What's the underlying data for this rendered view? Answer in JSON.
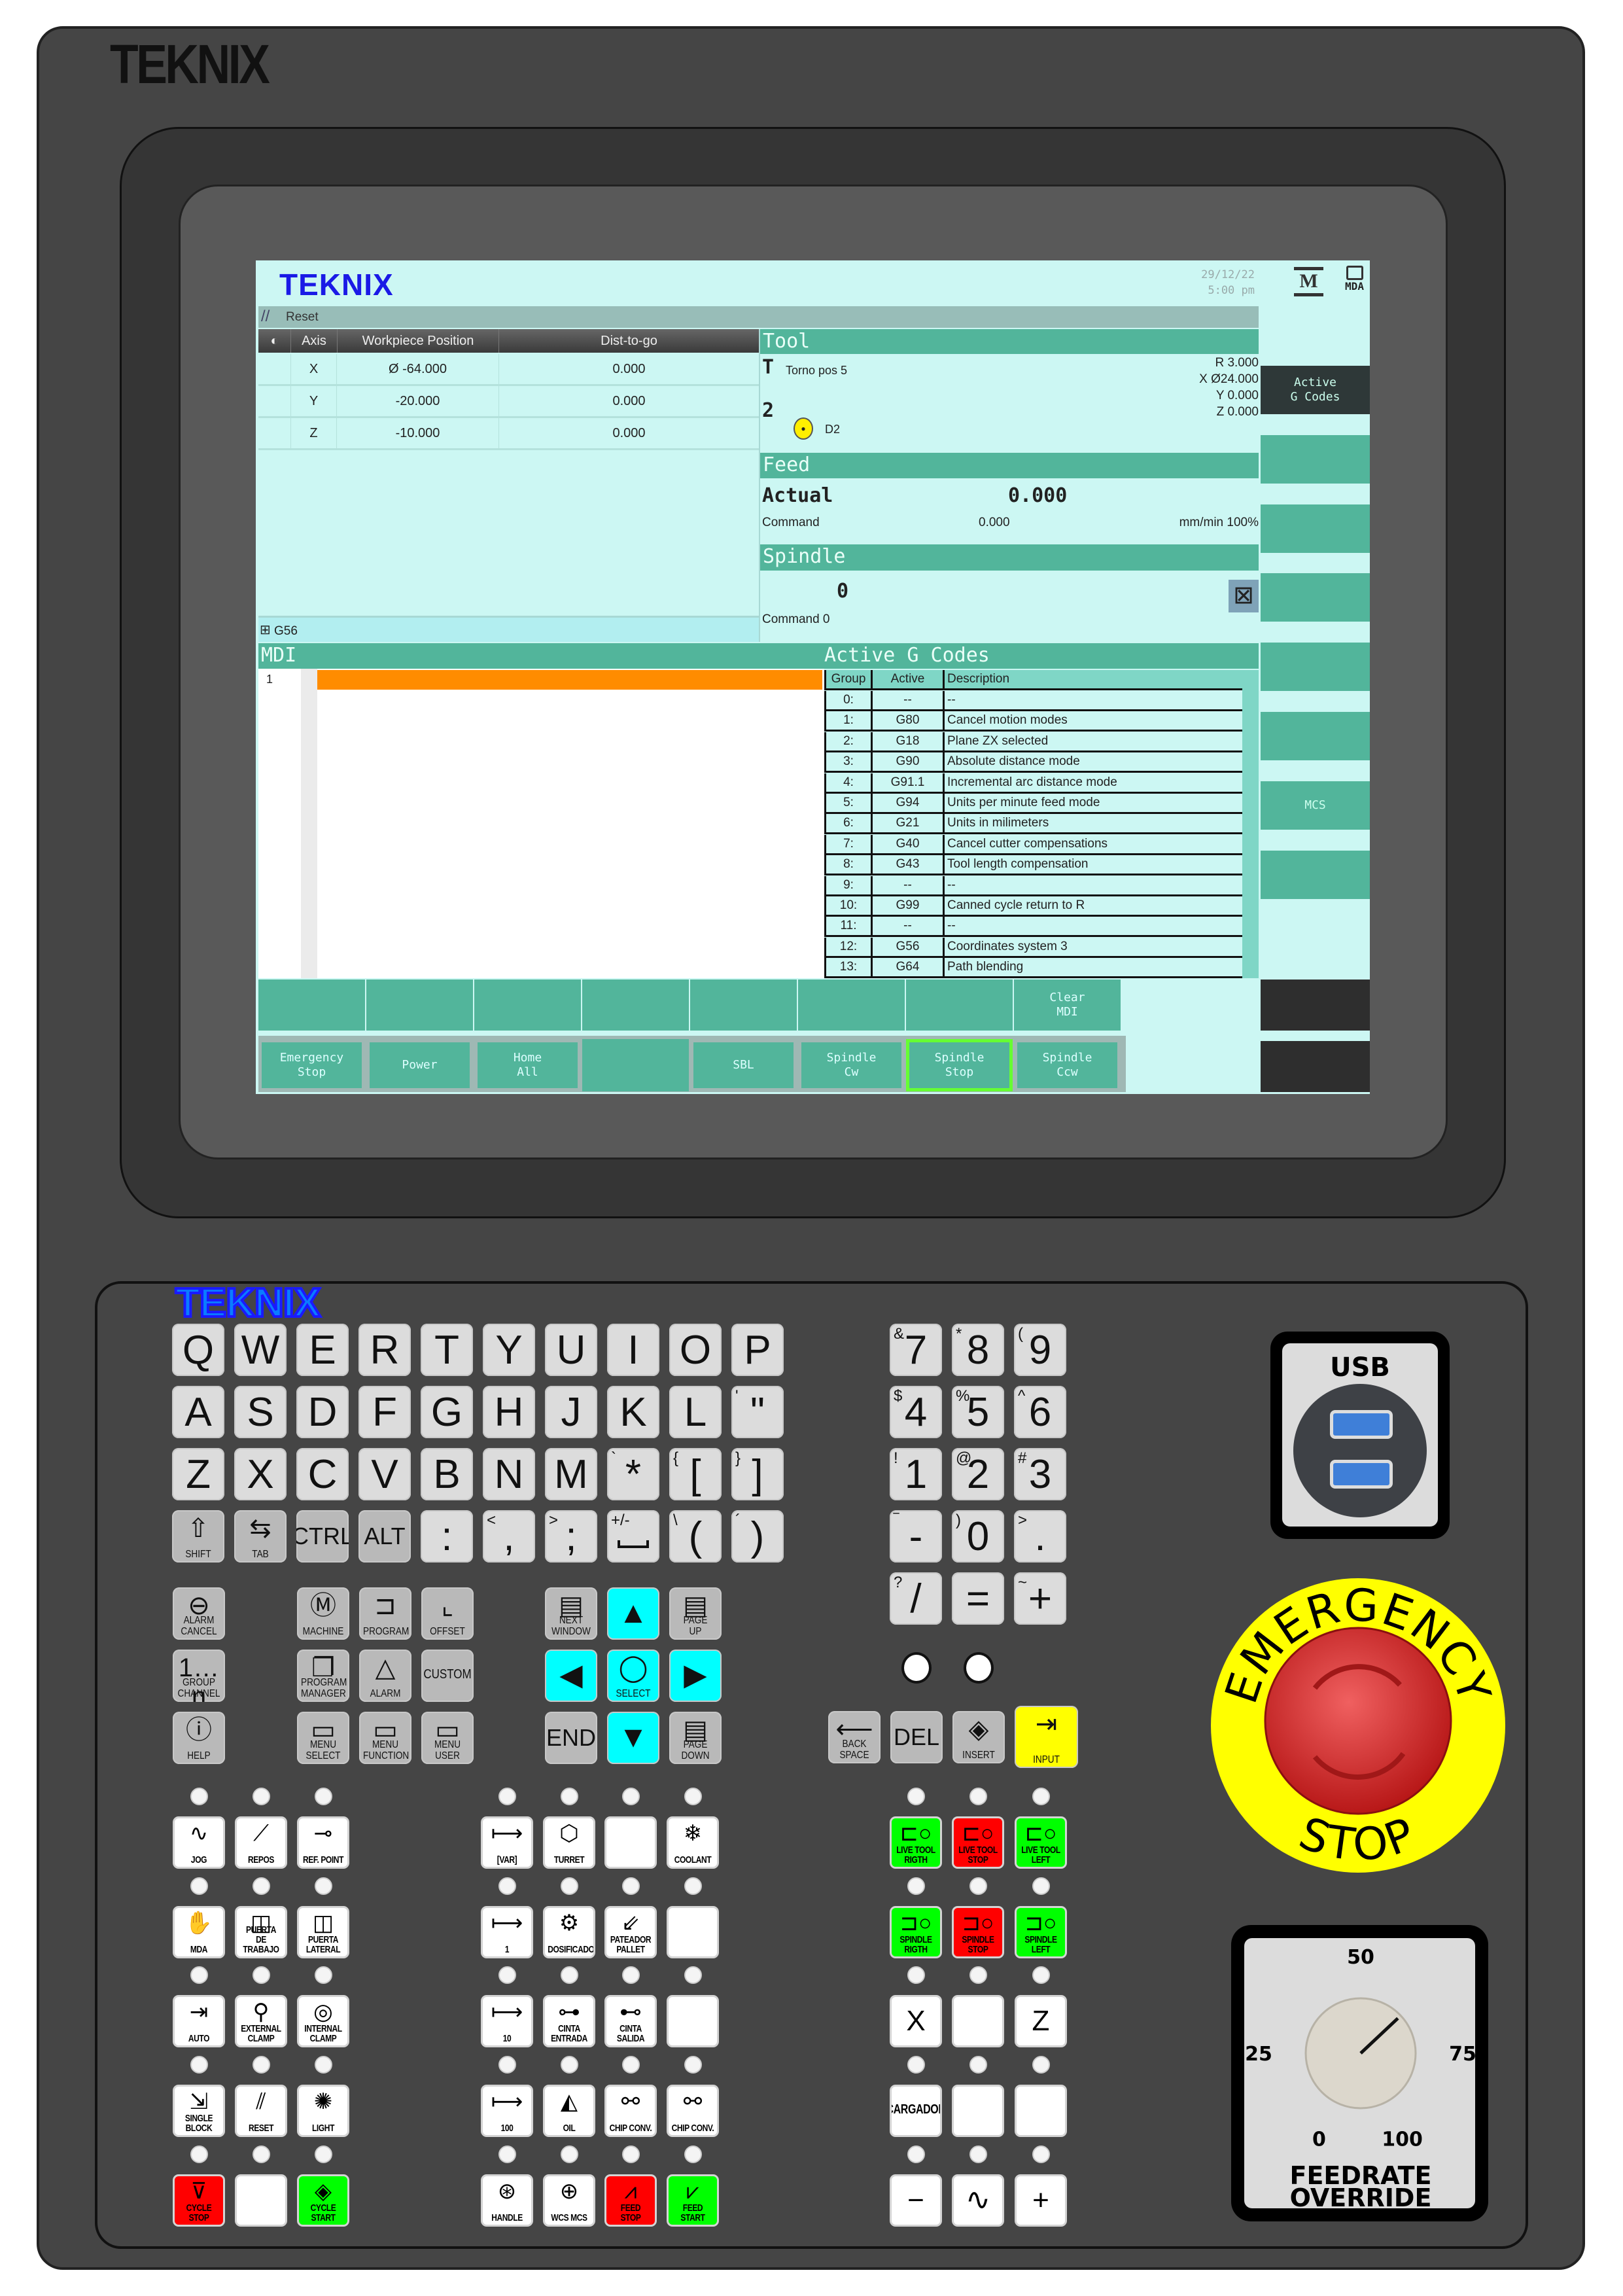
{
  "brand": "TEKNIX",
  "screen": {
    "logo": "TEKNIX",
    "date": "29/12/22",
    "time": "5:00 pm",
    "mode_icons": [
      "M",
      "MDA"
    ],
    "status": "Reset",
    "axes": {
      "headers": [
        "Axis",
        "Workpiece Position",
        "Dist-to-go"
      ],
      "rows": [
        [
          "X",
          "Ø -64.000",
          "0.000"
        ],
        [
          "Y",
          "-20.000",
          "0.000"
        ],
        [
          "Z",
          "-10.000",
          "0.000"
        ]
      ]
    },
    "wcs": "G56",
    "tool": {
      "title": "Tool",
      "t_label": "T",
      "name": "Torno pos 5",
      "number": "2",
      "d": "D2",
      "r": "R 3.000",
      "x": "X Ø24.000",
      "y": "Y 0.000",
      "z": "Z 0.000"
    },
    "feed": {
      "title": "Feed",
      "actual_label": "Actual",
      "actual": "0.000",
      "command_label": "Command",
      "command": "0.000",
      "unit": "mm/min 100%"
    },
    "spindle": {
      "title": "Spindle",
      "value": "0",
      "command": "Command 0"
    },
    "mdi": {
      "title": "MDI",
      "line": "1"
    },
    "gcodes": {
      "title": "Active G Codes",
      "headers": [
        "Group",
        "Active",
        "Description"
      ],
      "rows": [
        [
          "0:",
          "--",
          "--"
        ],
        [
          "1:",
          "G80",
          "Cancel motion modes"
        ],
        [
          "2:",
          "G18",
          "Plane ZX selected"
        ],
        [
          "3:",
          "G90",
          "Absolute distance mode"
        ],
        [
          "4:",
          "G91.1",
          "Incremental arc distance mode"
        ],
        [
          "5:",
          "G94",
          "Units per minute feed mode"
        ],
        [
          "6:",
          "G21",
          "Units in milimeters"
        ],
        [
          "7:",
          "G40",
          "Cancel cutter compensations"
        ],
        [
          "8:",
          "G43",
          "Tool length compensation"
        ],
        [
          "9:",
          "--",
          "--"
        ],
        [
          "10:",
          "G99",
          "Canned cycle return to R"
        ],
        [
          "11:",
          "--",
          "--"
        ],
        [
          "12:",
          "G56",
          "Coordinates system 3"
        ],
        [
          "13:",
          "G64",
          "Path blending"
        ]
      ]
    },
    "right_softkeys": [
      "Active\nG Codes",
      "",
      "",
      "",
      "",
      "",
      "MCS",
      ""
    ],
    "bottom_softkeys_1": [
      "",
      "",
      "",
      "",
      "",
      "",
      "",
      "Clear\nMDI"
    ],
    "bottom_softkeys_2": [
      "Emergency\nStop",
      "Power",
      "Home\nAll",
      "",
      "SBL",
      "Spindle\nCw",
      "Spindle\nStop",
      "Spindle\nCcw"
    ],
    "active_softkey": "Spindle\nStop",
    "colors": {
      "background": "#ccf7f3",
      "header": "#52b59b",
      "cursor_line": "#ff8c00",
      "logo": "#1a1ae6",
      "active_border": "#66ff33"
    }
  },
  "keyboard": {
    "alpha_rows": [
      [
        [
          "Q",
          ""
        ],
        [
          "W",
          ""
        ],
        [
          "E",
          ""
        ],
        [
          "R",
          ""
        ],
        [
          "T",
          ""
        ],
        [
          "Y",
          ""
        ],
        [
          "U",
          ""
        ],
        [
          "I",
          ""
        ],
        [
          "O",
          ""
        ],
        [
          "P",
          ""
        ]
      ],
      [
        [
          "A",
          ""
        ],
        [
          "S",
          ""
        ],
        [
          "D",
          ""
        ],
        [
          "F",
          ""
        ],
        [
          "G",
          ""
        ],
        [
          "H",
          ""
        ],
        [
          "J",
          ""
        ],
        [
          "K",
          ""
        ],
        [
          "L",
          ""
        ],
        [
          "\"",
          "'"
        ]
      ],
      [
        [
          "Z",
          ""
        ],
        [
          "X",
          ""
        ],
        [
          "C",
          ""
        ],
        [
          "V",
          ""
        ],
        [
          "B",
          ""
        ],
        [
          "N",
          ""
        ],
        [
          "M",
          ""
        ],
        [
          "*",
          "`"
        ],
        [
          "[",
          "{"
        ],
        [
          "]",
          "}"
        ]
      ],
      [
        [
          ":",
          ""
        ],
        [
          ",",
          "<"
        ],
        [
          ";",
          ">"
        ],
        [
          "",
          "+/-"
        ],
        [
          "(",
          "\\"
        ],
        [
          ")",
          "´"
        ]
      ]
    ],
    "modifier_keys": [
      {
        "label": "SHIFT",
        "icon": "shift-arrow"
      },
      {
        "label": "TAB",
        "icon": "tab-arrows"
      },
      {
        "label": "CTRL"
      },
      {
        "label": "ALT"
      }
    ],
    "numpad_rows": [
      [
        [
          "7",
          "&"
        ],
        [
          "8",
          "*"
        ],
        [
          "9",
          "("
        ]
      ],
      [
        [
          "4",
          "$"
        ],
        [
          "5",
          "%"
        ],
        [
          "6",
          "^"
        ]
      ],
      [
        [
          "1",
          "!"
        ],
        [
          "2",
          "@"
        ],
        [
          "3",
          "#"
        ]
      ],
      [
        [
          "-",
          "‾"
        ],
        [
          "0",
          ")"
        ],
        [
          ".",
          ">"
        ]
      ],
      [
        [
          "/",
          "?"
        ],
        [
          "=",
          ""
        ],
        [
          "+",
          "~"
        ]
      ]
    ],
    "edit_keys": [
      {
        "label": "BACK\nSPACE",
        "icon": "backspace-arrow"
      },
      {
        "label": "DEL"
      },
      {
        "label": "INSERT",
        "icon": "insert"
      },
      {
        "label": "INPUT",
        "icon": "input",
        "color": "#ffff00"
      }
    ],
    "function_left": [
      {
        "label": "ALARM\nCANCEL",
        "icon": "alarm-cancel"
      },
      {
        "label": "GROUP\nCHANNEL",
        "icon": "group-channel"
      },
      {
        "label": "HELP",
        "icon": "help"
      }
    ],
    "function_middle": [
      [
        {
          "label": "MACHINE",
          "icon": "machine"
        },
        {
          "label": "PROGRAM",
          "icon": "program"
        },
        {
          "label": "OFFSET",
          "icon": "offset"
        }
      ],
      [
        {
          "label": "PROGRAM\nMANAGER",
          "icon": "program-manager"
        },
        {
          "label": "ALARM",
          "icon": "alarm"
        },
        {
          "label": "CUSTOM"
        }
      ],
      [
        {
          "label": "MENU\nSELECT",
          "icon": "menu"
        },
        {
          "label": "MENU\nFUNCTION",
          "icon": "menu"
        },
        {
          "label": "MENU\nUSER",
          "icon": "menu"
        }
      ]
    ],
    "navigation": [
      [
        {
          "label": "NEXT\nWINDOW",
          "icon": "next-window"
        },
        {
          "label": "",
          "icon": "arrow-up",
          "color": "#00ffff"
        },
        {
          "label": "PAGE\nUP",
          "icon": "page-up"
        }
      ],
      [
        {
          "label": "",
          "icon": "arrow-left",
          "color": "#00ffff"
        },
        {
          "label": "SELECT",
          "icon": "select",
          "color": "#00ffff"
        },
        {
          "label": "",
          "icon": "arrow-right",
          "color": "#00ffff"
        }
      ],
      [
        {
          "label": "END"
        },
        {
          "label": "",
          "icon": "arrow-down",
          "color": "#00ffff"
        },
        {
          "label": "PAGE\nDOWN",
          "icon": "page-down"
        }
      ]
    ]
  },
  "machine_panel": {
    "group1": [
      [
        {
          "label": "JOG",
          "icon": "jog"
        },
        {
          "label": "REPOS",
          "icon": "repos"
        },
        {
          "label": "REF. POINT",
          "icon": "ref-point"
        }
      ],
      [
        {
          "label": "MDA",
          "icon": "mda"
        },
        {
          "label": "PUERTA\nDE TRABAJO",
          "icon": "door"
        },
        {
          "label": "PUERTA\nLATERAL",
          "icon": "door"
        }
      ],
      [
        {
          "label": "AUTO",
          "icon": "auto"
        },
        {
          "label": "EXTERNAL\nCLAMP",
          "icon": "external-clamp"
        },
        {
          "label": "INTERNAL\nCLAMP",
          "icon": "internal-clamp"
        }
      ],
      [
        {
          "label": "SINGLE\nBLOCK",
          "icon": "single-block"
        },
        {
          "label": "RESET",
          "icon": "reset"
        },
        {
          "label": "LIGHT",
          "icon": "light"
        }
      ],
      [
        {
          "label": "CYCLE\nSTOP",
          "icon": "cycle-stop",
          "color": "#ff0000"
        },
        {
          "label": ""
        },
        {
          "label": "CYCLE\nSTART",
          "icon": "cycle-start",
          "color": "#00ff00"
        }
      ]
    ],
    "group2": [
      [
        {
          "label": "[VAR]",
          "icon": "increment"
        },
        {
          "label": "TURRET",
          "icon": "turret"
        },
        {
          "label": ""
        },
        {
          "label": "COOLANT",
          "icon": "coolant"
        }
      ],
      [
        {
          "label": "1",
          "icon": "increment"
        },
        {
          "label": "DOSIFICADOR",
          "icon": "dosificador"
        },
        {
          "label": "PATEADOR\nPALLET",
          "icon": "pallet"
        },
        {
          "label": ""
        }
      ],
      [
        {
          "label": "10",
          "icon": "increment"
        },
        {
          "label": "CINTA\nENTRADA",
          "icon": "conveyor-in"
        },
        {
          "label": "CINTA\nSALIDA",
          "icon": "conveyor-out"
        },
        {
          "label": ""
        }
      ],
      [
        {
          "label": "100",
          "icon": "increment"
        },
        {
          "label": "OIL",
          "icon": "oil"
        },
        {
          "label": "CHIP CONV.",
          "icon": "chip-conveyor"
        },
        {
          "label": "CHIP CONV.",
          "icon": "chip-conveyor"
        }
      ],
      [
        {
          "label": "HANDLE",
          "icon": "handle"
        },
        {
          "label": "WCS MCS",
          "icon": "wcs-mcs"
        },
        {
          "label": "FEED\nSTOP",
          "icon": "feed-stop",
          "color": "#ff0000"
        },
        {
          "label": "FEED\nSTART",
          "icon": "feed-start",
          "color": "#00ff00"
        }
      ]
    ],
    "group3": [
      [
        {
          "label": "LIVE TOOL\nRIGTH",
          "icon": "live-tool",
          "color": "#00ff00"
        },
        {
          "label": "LIVE TOOL\nSTOP",
          "icon": "live-tool",
          "color": "#ff0000"
        },
        {
          "label": "LIVE TOOL\nLEFT",
          "icon": "live-tool",
          "color": "#00ff00"
        }
      ],
      [
        {
          "label": "SPINDLE\nRIGTH",
          "icon": "spindle",
          "color": "#00ff00"
        },
        {
          "label": "SPINDLE\nSTOP",
          "icon": "spindle",
          "color": "#ff0000"
        },
        {
          "label": "SPINDLE\nLEFT",
          "icon": "spindle",
          "color": "#00ff00"
        }
      ],
      [
        {
          "label": "X"
        },
        {
          "label": ""
        },
        {
          "label": "Z"
        }
      ],
      [
        {
          "label": "CARGADOR"
        },
        {
          "label": ""
        },
        {
          "label": ""
        }
      ],
      [
        {
          "label": "−"
        },
        {
          "label": "",
          "icon": "wave"
        },
        {
          "label": "+"
        }
      ]
    ]
  },
  "usb": {
    "label": "USB"
  },
  "emergency_stop": {
    "top_text": "EMERGENCY",
    "bottom_text": "STOP",
    "ring_color": "#ffff00",
    "knob_color": "#e03030"
  },
  "feedrate_override": {
    "title_line1": "FEEDRATE",
    "title_line2": "OVERRIDE",
    "scale_labels": [
      "0",
      "25",
      "50",
      "75",
      "100"
    ],
    "value": 63
  }
}
